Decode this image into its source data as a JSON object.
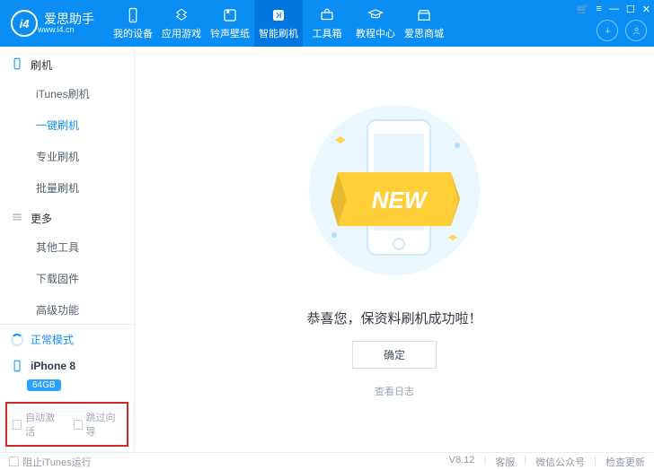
{
  "app": {
    "name": "爱思助手",
    "url": "www.i4.cn",
    "logo_text": "i4",
    "version": "V8.12"
  },
  "topnav": [
    {
      "label": "我的设备"
    },
    {
      "label": "应用游戏"
    },
    {
      "label": "铃声壁纸"
    },
    {
      "label": "智能刷机"
    },
    {
      "label": "工具箱"
    },
    {
      "label": "教程中心"
    },
    {
      "label": "爱思商城"
    }
  ],
  "sidebar": {
    "group1": "刷机",
    "group2": "更多",
    "itunes": "iTunes刷机",
    "oneclick": "一键刷机",
    "pro": "专业刷机",
    "batch": "批量刷机",
    "othertools": "其他工具",
    "firmware": "下载固件",
    "advanced": "高级功能",
    "status": "正常模式",
    "device": "iPhone 8",
    "capacity": "64GB",
    "auto_activate": "自动激活",
    "skip_guide": "跳过向导"
  },
  "main": {
    "message": "恭喜您，保资料刷机成功啦！",
    "ok": "确定",
    "viewlog": "查看日志"
  },
  "footer": {
    "block_itunes": "阻止iTunes运行",
    "support": "客服",
    "wechat": "微信公众号",
    "update": "检查更新"
  },
  "graphic": {
    "banner": "NEW"
  }
}
